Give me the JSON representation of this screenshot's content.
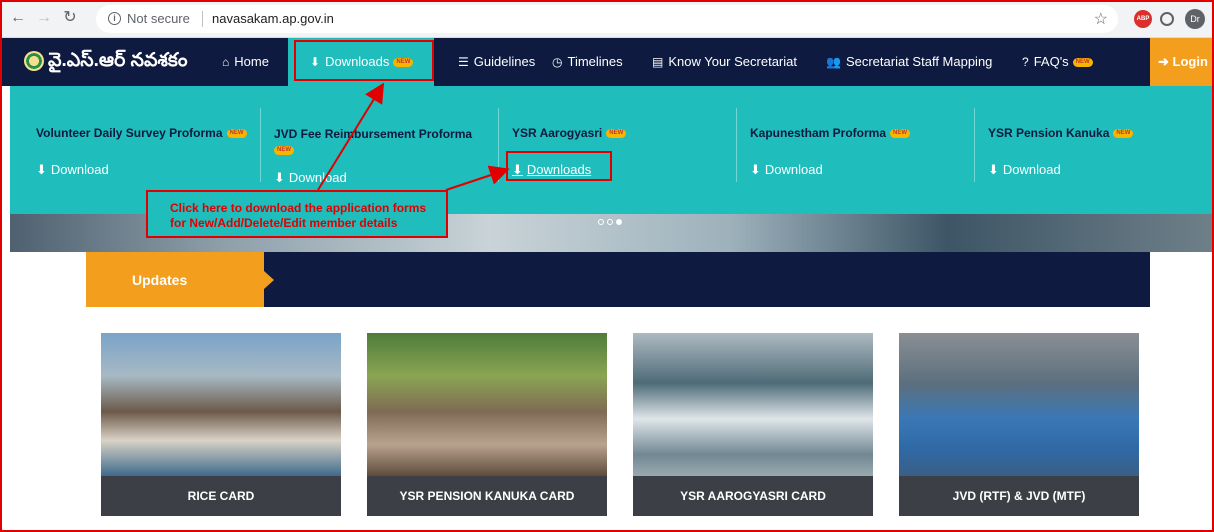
{
  "browser": {
    "security": "Not secure",
    "url": "navasakam.ap.gov.in",
    "profile": "Dr",
    "ext_label": "ABP"
  },
  "site": {
    "logo_text": "వై.ఎస్.ఆర్ నవశకం",
    "new_badge": "NEW",
    "nav": {
      "home": "Home",
      "downloads": "Downloads",
      "guidelines": "Guidelines",
      "timelines": "Timelines",
      "know": "Know Your Secretariat",
      "staff": "Secretariat Staff Mapping",
      "faq": "FAQ's",
      "login": "Login"
    }
  },
  "dropdown": {
    "cols": [
      {
        "title": "Volunteer Daily Survey Proforma",
        "link": "Download"
      },
      {
        "title": "JVD Fee Reimbursement Proforma",
        "link": "Download"
      },
      {
        "title": "YSR Aarogyasri",
        "link": "Downloads"
      },
      {
        "title": "Kapunestham Proforma",
        "link": "Download"
      },
      {
        "title": "YSR Pension Kanuka",
        "link": "Download"
      }
    ]
  },
  "callout": {
    "line1": "Click here to download the application forms",
    "line2": "for New/Add/Delete/Edit member details"
  },
  "updates": {
    "label": "Updates"
  },
  "cards": [
    {
      "caption": "RICE CARD"
    },
    {
      "caption": "YSR PENSION KANUKA CARD"
    },
    {
      "caption": "YSR AAROGYASRI CARD"
    },
    {
      "caption": "JVD (RTF) & JVD (MTF)"
    }
  ],
  "colors": {
    "nav_bg": "#0e1a3f",
    "teal": "#1fbdbc",
    "orange": "#f49e1e",
    "annotation_red": "#e00000"
  }
}
